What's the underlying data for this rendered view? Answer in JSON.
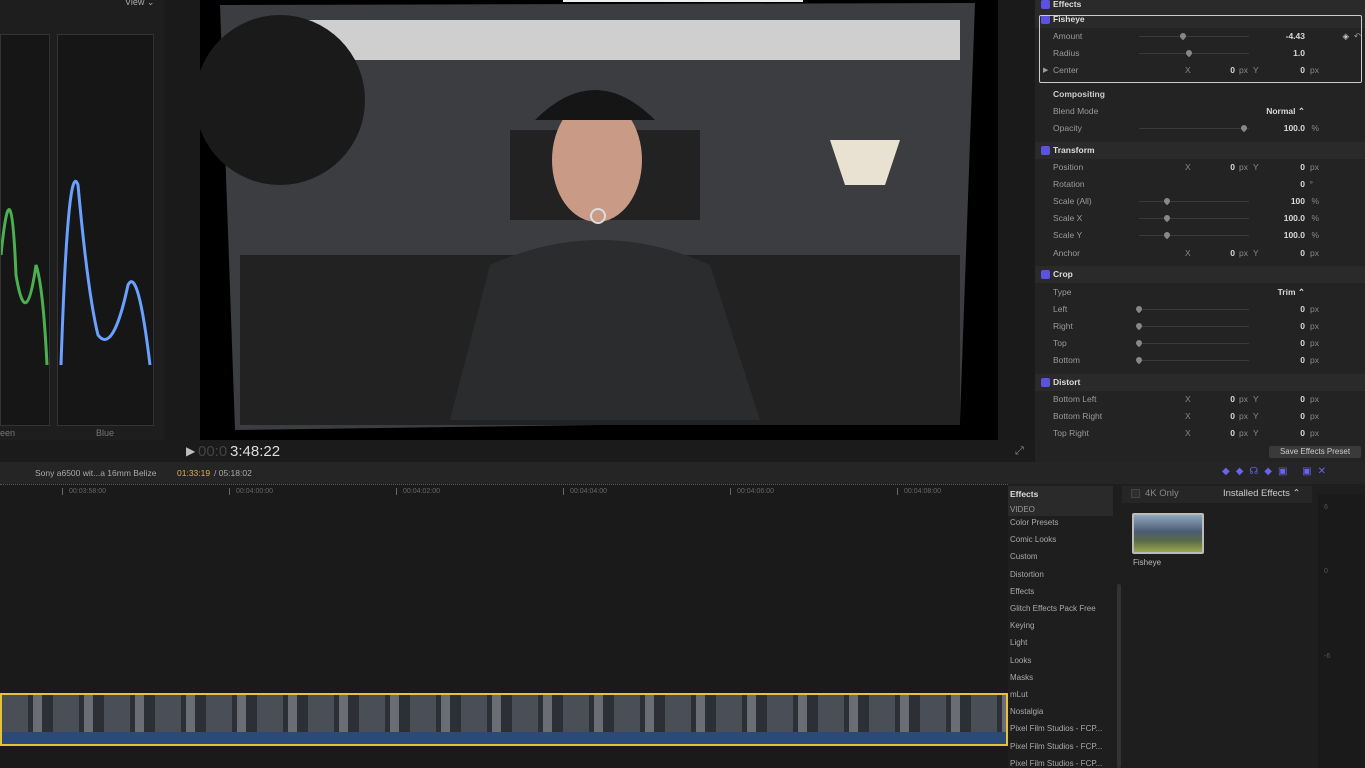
{
  "scopes": {
    "view_label": "View ⌄",
    "labels": [
      "een",
      "Blue"
    ]
  },
  "viewer": {
    "timecode_dim": "00:0",
    "timecode": "3:48:22"
  },
  "inspector": {
    "rows": [
      {
        "type": "hdr",
        "label": "Effects",
        "check": true
      },
      {
        "type": "hdr",
        "label": "Fisheye",
        "check": true
      },
      {
        "label": "Amount",
        "value": "-4.43",
        "slider": 0.4
      },
      {
        "label": "Radius",
        "value": "1.0",
        "slider": 0.45
      },
      {
        "label": "Center",
        "x": "0",
        "y": "0",
        "unit": "px"
      },
      {
        "type": "sec",
        "label": "Compositing"
      },
      {
        "label": "Blend Mode",
        "value": "Normal ⌃"
      },
      {
        "label": "Opacity",
        "value": "100.0",
        "unit": "%",
        "slider": 0.95
      },
      {
        "type": "hdr",
        "label": "Transform",
        "check": true
      },
      {
        "label": "Position",
        "x": "0",
        "y": "0",
        "unit": "px"
      },
      {
        "label": "Rotation",
        "value": "0",
        "unit": "°"
      },
      {
        "label": "Scale (All)",
        "value": "100",
        "unit": "%",
        "slider": 0.25
      },
      {
        "label": "Scale X",
        "value": "100.0",
        "unit": "%",
        "slider": 0.25
      },
      {
        "label": "Scale Y",
        "value": "100.0",
        "unit": "%",
        "slider": 0.25
      },
      {
        "label": "Anchor",
        "x": "0",
        "y": "0",
        "unit": "px"
      },
      {
        "type": "hdr",
        "label": "Crop",
        "check": true
      },
      {
        "label": "Type",
        "value": "Trim ⌃"
      },
      {
        "label": "Left",
        "value": "0",
        "unit": "px",
        "slider": 0
      },
      {
        "label": "Right",
        "value": "0",
        "unit": "px",
        "slider": 0
      },
      {
        "label": "Top",
        "value": "0",
        "unit": "px",
        "slider": 0
      },
      {
        "label": "Bottom",
        "value": "0",
        "unit": "px",
        "slider": 0
      },
      {
        "type": "hdr",
        "label": "Distort",
        "check": true
      },
      {
        "label": "Bottom Left",
        "x": "0",
        "y": "0",
        "unit": "px"
      },
      {
        "label": "Bottom Right",
        "x": "0",
        "y": "0",
        "unit": "px"
      },
      {
        "label": "Top Right",
        "x": "0",
        "y": "0",
        "unit": "px"
      }
    ],
    "save_preset": "Save Effects Preset"
  },
  "timeline": {
    "clip_name": "Sony a6500 wit...a 16mm Belize",
    "position": "01:33:19",
    "duration": "/ 05:18:02",
    "ticks": [
      "00:03:58:00",
      "00:04:00:00",
      "00:04:02:00",
      "00:04:04:00",
      "00:04:06:00",
      "00:04:08:00"
    ]
  },
  "browser": {
    "title": "Effects",
    "section": "VIDEO",
    "four_k": "4K Only",
    "filter": "Installed Effects ⌃",
    "categories": [
      "Color Presets",
      "Comic Looks",
      "Custom",
      "Distortion",
      "Effects",
      "Glitch Effects Pack Free",
      "Keying",
      "Light",
      "Looks",
      "Masks",
      "mLut",
      "Nostalgia",
      "Pixel Film Studios - FCP...",
      "Pixel Film Studios - FCP...",
      "Pixel Film Studios - FCP..."
    ],
    "thumb_label": "Fisheye",
    "meter_ticks": [
      "6",
      "0",
      "-6"
    ]
  },
  "colors": {
    "accent": "#5b52e0",
    "timecode": "#e0b040",
    "selection": "#e6c23a"
  }
}
